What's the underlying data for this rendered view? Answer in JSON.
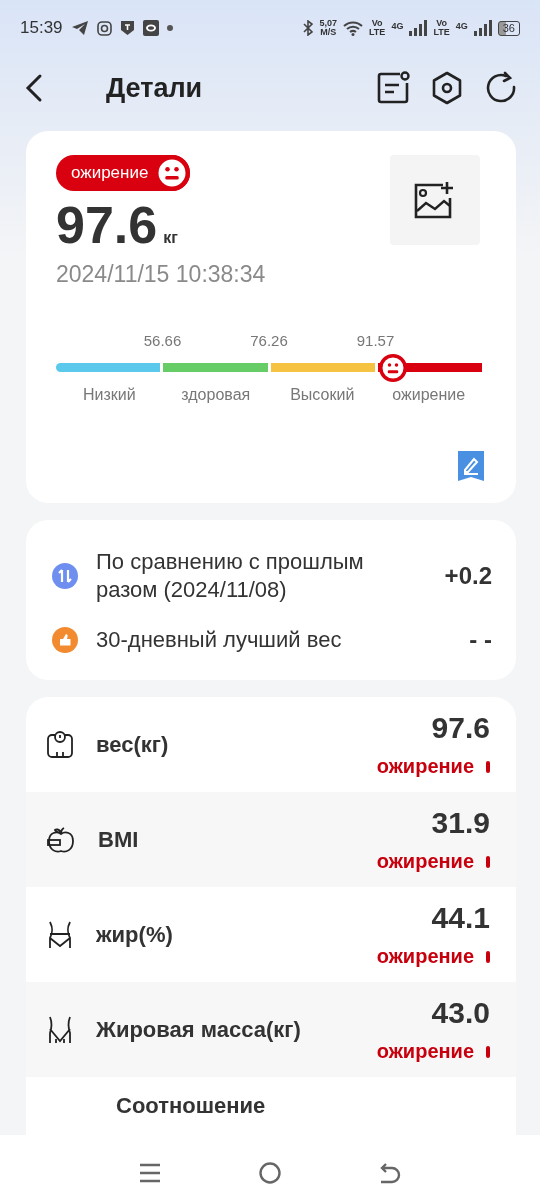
{
  "status_bar": {
    "time": "15:39",
    "speed": "5,07",
    "speed_unit": "M/S",
    "sim1_volte": "Vo",
    "sim1_lte": "LTE",
    "sim1_net": "4G",
    "sim2_volte": "Vo",
    "sim2_lte": "LTE",
    "sim2_net": "4G",
    "battery": "36"
  },
  "header": {
    "title": "Детали"
  },
  "summary": {
    "badge": "ожирение",
    "weight": "97.6",
    "unit": "кг",
    "timestamp": "2024/11/15 10:38:34",
    "scale": {
      "thresholds": [
        "56.66",
        "76.26",
        "91.57"
      ],
      "level": 0.79,
      "segments": [
        {
          "label": "Низкий",
          "color": "#5bc8ec"
        },
        {
          "label": "здоровая",
          "color": "#66cc66"
        },
        {
          "label": "Высокий",
          "color": "#f5c242"
        },
        {
          "label": "ожирение",
          "color": "#d9000f"
        }
      ]
    }
  },
  "comparison": [
    {
      "kind": "change",
      "label": "По сравнению с прошлым разом (2024/11/08)",
      "value": "+0.2"
    },
    {
      "kind": "best",
      "label": "30-дневный лучший вес",
      "value": "- -"
    }
  ],
  "metrics": [
    {
      "kind": "scale",
      "name": "вес(кг)",
      "value": "97.6",
      "status": "ожирение"
    },
    {
      "kind": "apple",
      "name": "BMI",
      "value": "31.9",
      "status": "ожирение"
    },
    {
      "kind": "waist",
      "name": "жир(%)",
      "value": "44.1",
      "status": "ожирение"
    },
    {
      "kind": "hips",
      "name": "Жировая масса(кг)",
      "value": "43.0",
      "status": "ожирение"
    },
    {
      "kind": "text",
      "name": "Соотношение"
    }
  ]
}
